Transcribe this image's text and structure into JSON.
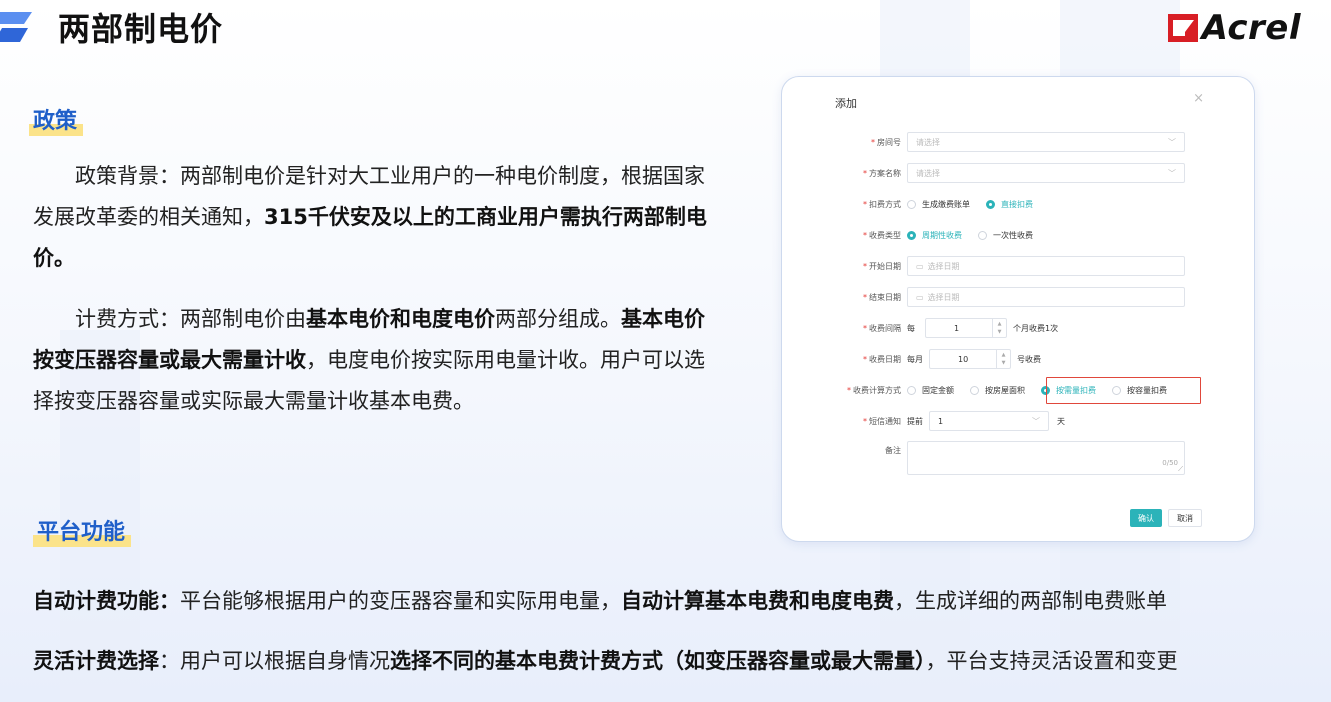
{
  "header": {
    "title": "两部制电价",
    "brand": "Acrel",
    "brand_color": "#d81e25"
  },
  "policy": {
    "heading": "政策",
    "p1_a": "政策背景：两部制电价是针对大工业用户的一种电价制度，根据国家发展改革委的相关通知，",
    "p1_b": "315千伏安及以上的工商业用户需执行两部制电价。",
    "p2_a": "计费方式：两部制电价由",
    "p2_b": "基本电价和电度电价",
    "p2_c": "两部分组成。",
    "p2_d": "基本电价按变压器容量或最大需量计收",
    "p2_e": "，电度电价按实际用电量计收。用户可以选择按变压器容量或实际最大需量计收基本电费。"
  },
  "platform": {
    "heading": "平台功能",
    "f1_label": "自动计费功能：",
    "f1_a": "平台能够根据用户的变压器容量和实际用电量，",
    "f1_b": "自动计算基本电费和电度电费",
    "f1_c": "，生成详细的两部制电费账单",
    "f2_label": "灵活计费选择",
    "f2_a": "：用户可以根据自身情况",
    "f2_b": "选择不同的基本电费计费方式（如变压器容量或最大需量）",
    "f2_c": "，平台支持灵活设置和变更"
  },
  "dialog": {
    "title": "添加",
    "close": "×",
    "req_mark": "*",
    "room_label": "房间号",
    "room_placeholder": "请选择",
    "plan_label": "方案名称",
    "plan_placeholder": "请选择",
    "deduct_label": "扣费方式",
    "deduct_opt1": "生成缴费账单",
    "deduct_opt2": "直接扣费",
    "type_label": "收费类型",
    "type_opt1": "周期性收费",
    "type_opt2": "一次性收费",
    "start_label": "开始日期",
    "start_placeholder": "选择日期",
    "end_label": "结束日期",
    "end_placeholder": "选择日期",
    "interval_label": "收费间隔",
    "interval_prefix": "每",
    "interval_value": "1",
    "interval_suffix": "个月收费1次",
    "day_label": "收费日期",
    "day_prefix": "每月",
    "day_value": "10",
    "day_suffix": "号收费",
    "calc_label": "收费计算方式",
    "calc_opt1": "固定金额",
    "calc_opt2": "按房屋面积",
    "calc_opt3": "按需量扣费",
    "calc_opt4": "按容量扣费",
    "sms_label": "短信通知",
    "sms_prefix": "提前",
    "sms_value": "1",
    "sms_suffix": "天",
    "remark_label": "备注",
    "remark_count": "0/50",
    "ok": "确认",
    "cancel": "取消",
    "accent": "#2bb3b9",
    "highlight": "#e0473b"
  }
}
